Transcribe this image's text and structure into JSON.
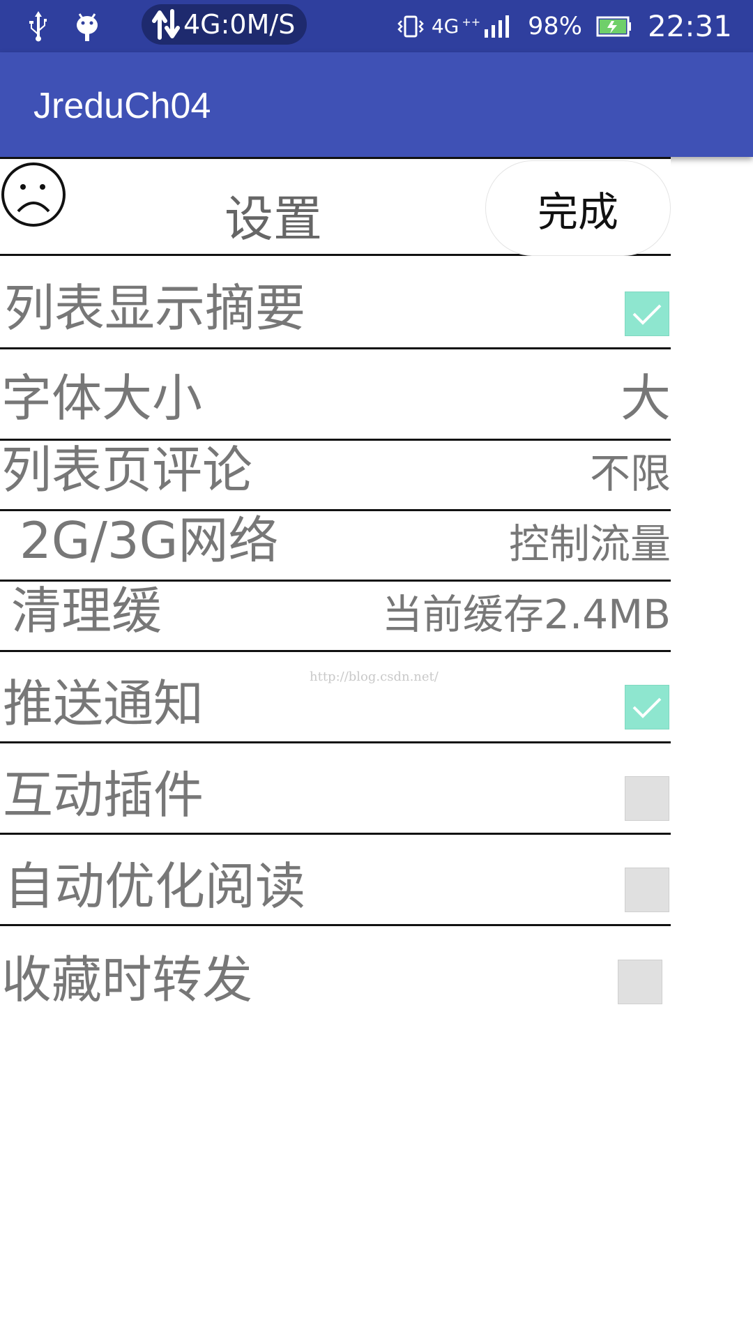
{
  "status_bar": {
    "icons": [
      "usb-icon",
      "android-debug-icon",
      "data-arrows-icon",
      "vibrate-icon",
      "signal-icon",
      "battery-icon"
    ],
    "network_speed": "4G:0M/S",
    "network_type": "4G",
    "network_sup": "++",
    "battery_percent": "98%",
    "time": "22:31"
  },
  "app_bar": {
    "title": "JreduCh04",
    "color": "#3f51b5"
  },
  "header": {
    "icon": "sad-face-icon",
    "title": "设置",
    "done_label": "完成"
  },
  "settings": {
    "list_summary": {
      "label": "列表显示摘要",
      "checked": true
    },
    "font_size": {
      "label": "字体大小",
      "value": "大"
    },
    "list_comments": {
      "label": "列表页评论",
      "value": "不限"
    },
    "network_2g3g": {
      "label": "2G/3G网络",
      "value": "控制流量"
    },
    "clear_cache": {
      "label": "清理缓",
      "value": "当前缓存2.4MB"
    },
    "push_notify": {
      "label": "推送通知",
      "checked": true
    },
    "interactive_plugin": {
      "label": "互动插件",
      "checked": false
    },
    "auto_optimize": {
      "label": "自动优化阅读",
      "checked": false
    },
    "forward_on_favorite": {
      "label": "收藏时转发",
      "checked": false
    }
  },
  "watermark": "http://blog.csdn.net/",
  "colors": {
    "status_bar": "#2f3f9e",
    "checkbox_checked": "#8ee6cf",
    "checkbox_unchecked": "#e0e0e0"
  }
}
